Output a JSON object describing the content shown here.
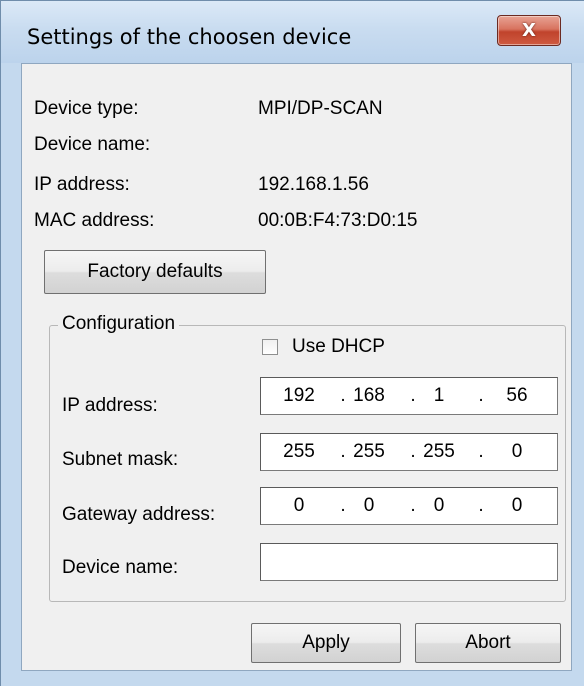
{
  "window": {
    "title": "Settings of the choosen device",
    "close_glyph": "X"
  },
  "info": {
    "device_type_label": "Device type:",
    "device_type_value": "MPI/DP-SCAN",
    "device_name_label": "Device name:",
    "device_name_value": "",
    "ip_label": "IP address:",
    "ip_value": "192.168.1.56",
    "mac_label": "MAC address:",
    "mac_value": "00:0B:F4:73:D0:15"
  },
  "factory_defaults_label": "Factory defaults",
  "config": {
    "group_label": "Configuration",
    "use_dhcp_label": "Use DHCP",
    "use_dhcp_checked": false,
    "ip_label": "IP address:",
    "ip_octets": [
      "192",
      "168",
      "1",
      "56"
    ],
    "subnet_label": "Subnet mask:",
    "subnet_octets": [
      "255",
      "255",
      "255",
      "0"
    ],
    "gateway_label": "Gateway address:",
    "gateway_octets": [
      "0",
      "0",
      "0",
      "0"
    ],
    "device_name_label": "Device name:",
    "device_name_value": "",
    "octet_separator": "."
  },
  "buttons": {
    "apply": "Apply",
    "abort": "Abort"
  }
}
